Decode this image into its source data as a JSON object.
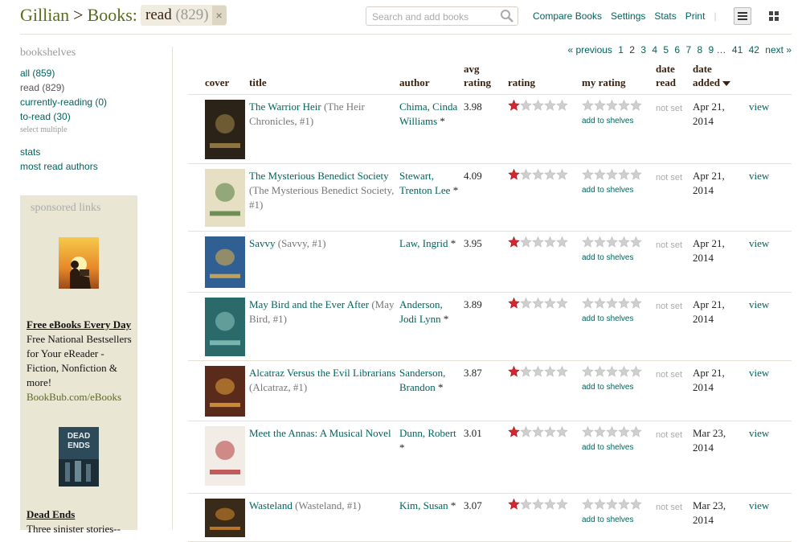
{
  "header": {
    "user": "Gillian",
    "separator": ">",
    "books": "Books:",
    "shelf": "read",
    "shelf_count": "(829)",
    "remove": "×",
    "search_placeholder": "Search and add books",
    "links": [
      "Compare Books",
      "Settings",
      "Stats",
      "Print"
    ]
  },
  "sidebar": {
    "heading": "bookshelves",
    "shelves": [
      {
        "label": "all (859)"
      },
      {
        "label": "read (829)"
      },
      {
        "label": "currently-reading (0)"
      },
      {
        "label": "to-read (30)"
      }
    ],
    "select_multiple": "select multiple",
    "stats": "stats",
    "most_read": "most read authors",
    "sponsored": "sponsored links",
    "ad1": {
      "title": "Free eBooks Every Day",
      "body": "Free National Bestsellers for Your eReader - Fiction, Nonfiction & more!",
      "url": "BookBub.com/eBooks"
    },
    "ad2": {
      "cover_text": "DEAD ENDS",
      "title": "Dead Ends",
      "body": "Three sinister stories--"
    }
  },
  "pager": {
    "previous": "« previous",
    "pages_before": [
      "1"
    ],
    "current": "2",
    "pages_after": [
      "3",
      "4",
      "5",
      "6",
      "7",
      "8",
      "9"
    ],
    "ellipsis": "…",
    "last_pages": [
      "41",
      "42"
    ],
    "next": "next »"
  },
  "columns": {
    "cover": "cover",
    "title": "title",
    "author": "author",
    "avg_rating_1": "avg",
    "avg_rating_2": "rating",
    "rating": "rating",
    "my_rating": "my rating",
    "date_read_1": "date",
    "date_read_2": "read",
    "date_added_1": "date",
    "date_added_2": "added"
  },
  "rows": [
    {
      "title": "The Warrior Heir",
      "series": "(The Heir Chronicles, #1)",
      "author_line1": "Chima, Cinda",
      "author_line2": "Williams",
      "avg": "3.98",
      "rating": 1,
      "my_rating": 0,
      "add": "add to shelves",
      "date_read": "not set",
      "date_added_1": "Apr 21,",
      "date_added_2": "2014",
      "view": "view",
      "cover_color": "#2b2218",
      "cover_accent": "#a88b4a"
    },
    {
      "title": "The Mysterious Benedict Society",
      "series": "(The Mysterious Benedict Society, #1)",
      "author_line1": "Stewart,",
      "author_line2": "Trenton Lee",
      "avg": "4.09",
      "rating": 1,
      "my_rating": 0,
      "add": "add to shelves",
      "date_read": "not set",
      "date_added_1": "Apr 21,",
      "date_added_2": "2014",
      "view": "view",
      "cover_color": "#e7dfc4",
      "cover_accent": "#4f7a3a"
    },
    {
      "title": "Savvy",
      "series": "(Savvy, #1)",
      "author_line1": "Law, Ingrid",
      "author_line2": "",
      "avg": "3.95",
      "rating": 1,
      "my_rating": 0,
      "add": "add to shelves",
      "date_read": "not set",
      "date_added_1": "Apr 21,",
      "date_added_2": "2014",
      "view": "view",
      "cover_color": "#2f5f93",
      "cover_accent": "#e6b04a"
    },
    {
      "title": "May Bird and the Ever After",
      "series": "(May Bird, #1)",
      "author_line1": "Anderson,",
      "author_line2": "Jodi Lynn",
      "avg": "3.89",
      "rating": 1,
      "my_rating": 0,
      "add": "add to shelves",
      "date_read": "not set",
      "date_added_1": "Apr 21,",
      "date_added_2": "2014",
      "view": "view",
      "cover_color": "#2a6a6a",
      "cover_accent": "#8fc7c0"
    },
    {
      "title": "Alcatraz Versus the Evil Librarians",
      "series": "(Alcatraz, #1)",
      "author_line1": "Sanderson,",
      "author_line2": "Brandon",
      "avg": "3.87",
      "rating": 1,
      "my_rating": 0,
      "add": "add to shelves",
      "date_read": "not set",
      "date_added_1": "Apr 21,",
      "date_added_2": "2014",
      "view": "view",
      "cover_color": "#5a2a1a",
      "cover_accent": "#e3a23a"
    },
    {
      "title": "Meet the Annas: A Musical Novel",
      "series": "",
      "author_line1": "Dunn, Robert",
      "author_line2": "",
      "avg": "3.01",
      "rating": 1,
      "my_rating": 0,
      "add": "add to shelves",
      "date_read": "not set",
      "date_added_1": "Mar 23,",
      "date_added_2": "2014",
      "view": "view",
      "cover_color": "#f2ece6",
      "cover_accent": "#b33a3a"
    },
    {
      "title": "Wasteland",
      "series": "(Wasteland, #1)",
      "author_line1": "Kim, Susan",
      "author_line2": "",
      "avg": "3.07",
      "rating": 1,
      "my_rating": 0,
      "add": "add to shelves",
      "date_read": "not set",
      "date_added_1": "Mar 23,",
      "date_added_2": "2014",
      "view": "view",
      "cover_color": "#3a2a1a",
      "cover_accent": "#d98a2a"
    }
  ],
  "colors": {
    "link": "#00635d",
    "brown": "#382110",
    "star_on": "#d7262f",
    "star_off": "#cfcfcf"
  }
}
